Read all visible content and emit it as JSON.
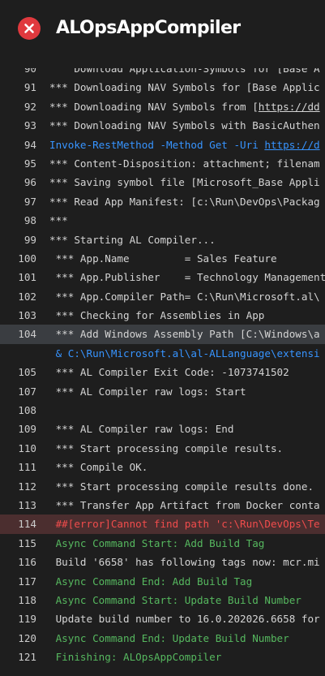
{
  "header": {
    "status_icon": "error-x-icon",
    "status_color": "#e0393e",
    "title": "ALOpsAppCompiler"
  },
  "log": {
    "lines": [
      {
        "n": "90",
        "t": "    Download Application-Symbols for [Base A",
        "kind": "normal"
      },
      {
        "n": "91",
        "t": "*** Downloading NAV Symbols for [Base Applic",
        "kind": "normal"
      },
      {
        "n": "92",
        "t": "*** Downloading NAV Symbols from [",
        "link": "https://dd",
        "kind": "normal"
      },
      {
        "n": "93",
        "t": "*** Downloading NAV Symbols with BasicAuthen",
        "kind": "normal"
      },
      {
        "n": "94",
        "t": "Invoke-RestMethod -Method Get -Uri ",
        "link": "https://d",
        "kind": "cmd"
      },
      {
        "n": "95",
        "t": "*** Content-Disposition: attachment; filenam",
        "kind": "normal"
      },
      {
        "n": "96",
        "t": "*** Saving symbol file [Microsoft_Base Appli",
        "kind": "normal"
      },
      {
        "n": "97",
        "t": "*** Read App Manifest: [c:\\Run\\DevOps\\Packag",
        "kind": "normal"
      },
      {
        "n": "98",
        "t": "***",
        "kind": "normal"
      },
      {
        "n": "99",
        "t": "*** Starting AL Compiler...",
        "kind": "normal"
      },
      {
        "n": "100",
        "t": " *** App.Name         = Sales Feature",
        "kind": "normal"
      },
      {
        "n": "101",
        "t": " *** App.Publisher    = Technology Management",
        "kind": "normal"
      },
      {
        "n": "102",
        "t": " *** App.Compiler Path= C:\\Run\\Microsoft.al\\",
        "kind": "normal"
      },
      {
        "n": "103",
        "t": " *** Checking for Assemblies in App",
        "kind": "normal"
      },
      {
        "n": "104",
        "t": " *** Add Windows Assembly Path [C:\\Windows\\a",
        "kind": "sel"
      },
      {
        "n": "",
        "t": " & C:\\Run\\Microsoft.al\\al-ALLanguage\\extensi",
        "kind": "cmd"
      },
      {
        "n": "105",
        "t": " *** AL Compiler Exit Code: -1073741502",
        "kind": "normal"
      },
      {
        "n": "107",
        "t": " *** AL Compiler raw logs: Start",
        "kind": "normal"
      },
      {
        "n": "108",
        "t": "",
        "kind": "normal"
      },
      {
        "n": "109",
        "t": " *** AL Compiler raw logs: End",
        "kind": "normal"
      },
      {
        "n": "110",
        "t": " *** Start processing compile results.",
        "kind": "normal"
      },
      {
        "n": "111",
        "t": " *** Compile OK.",
        "kind": "normal"
      },
      {
        "n": "112",
        "t": " *** Start processing compile results done.",
        "kind": "normal"
      },
      {
        "n": "113",
        "t": " *** Transfer App Artifact from Docker conta",
        "kind": "normal"
      },
      {
        "n": "114",
        "t": " ##[error]Cannot find path 'c:\\Run\\DevOps\\Te",
        "kind": "err"
      },
      {
        "n": "115",
        "t": " Async Command Start: Add Build Tag",
        "kind": "green"
      },
      {
        "n": "116",
        "t": " Build '6658' has following tags now: mcr.mi",
        "kind": "normal"
      },
      {
        "n": "117",
        "t": " Async Command End: Add Build Tag",
        "kind": "green"
      },
      {
        "n": "118",
        "t": " Async Command Start: Update Build Number",
        "kind": "green"
      },
      {
        "n": "119",
        "t": " Update build number to 16.0.202026.6658 for",
        "kind": "normal"
      },
      {
        "n": "120",
        "t": " Async Command End: Update Build Number",
        "kind": "green"
      },
      {
        "n": "121",
        "t": " Finishing: ALOpsAppCompiler",
        "kind": "green"
      }
    ]
  }
}
